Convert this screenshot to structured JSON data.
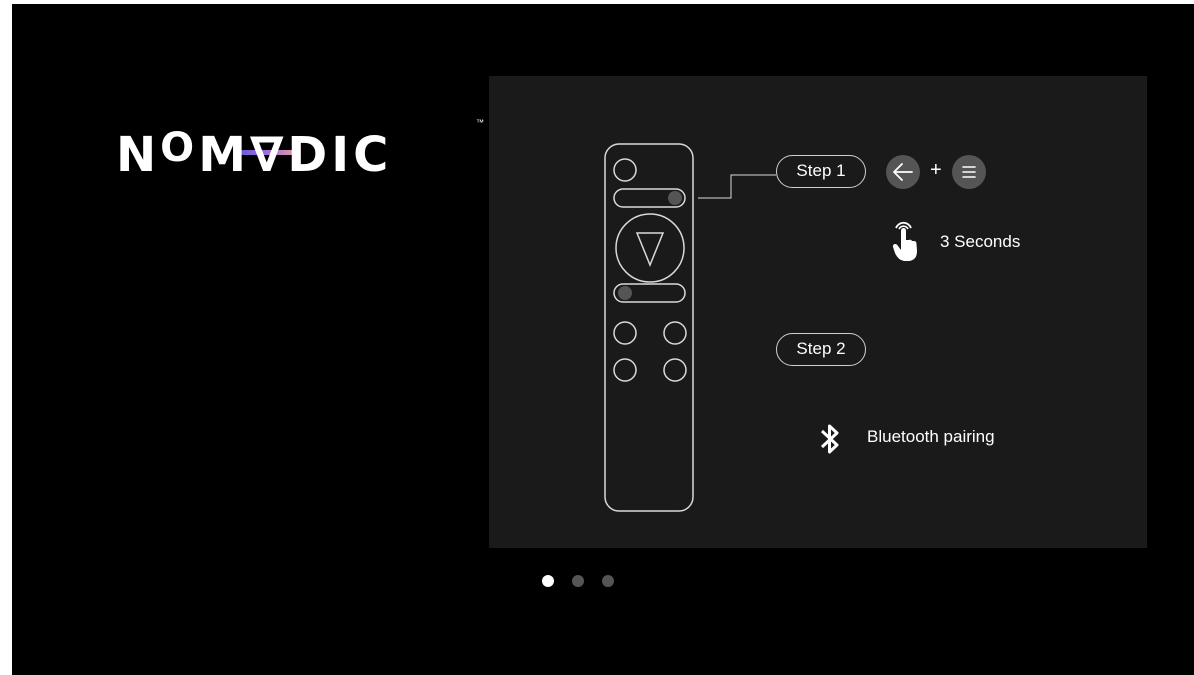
{
  "brand": {
    "logo_text_before": "N",
    "logo_o": "O",
    "logo_text_after": "M∇DIC",
    "trademark": "™"
  },
  "instructions": {
    "step1_label": "Step 1",
    "step1_combo_separator": "+",
    "step1_buttons": [
      "back-arrow-icon",
      "menu-icon"
    ],
    "hold_duration_text": "3  Seconds",
    "step2_label": "Step 2",
    "step2_action_text": "Bluetooth pairing"
  },
  "pagination": {
    "pages": 3,
    "active_index": 0
  },
  "colors": {
    "background": "#000000",
    "panel": "#1a1a1a",
    "button_fill": "#555555",
    "outline": "#d9d9d9",
    "logo_gradient_start": "#6a5bd6",
    "logo_gradient_end": "#e39aa8"
  }
}
